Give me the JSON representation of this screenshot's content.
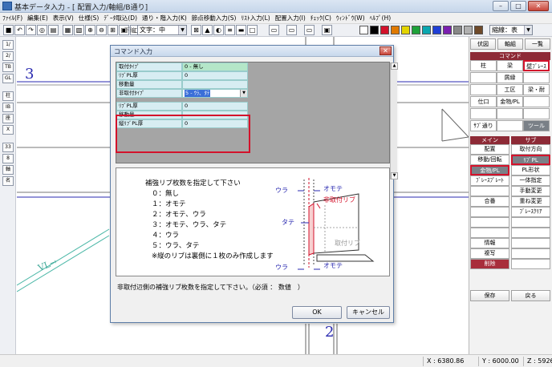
{
  "window": {
    "title": "基本データ入力 - [ 配置入力/軸組/B通り]"
  },
  "menu": [
    "ﾌｧｲﾙ(F)",
    "編集(E)",
    "表示(V)",
    "仕様(S)",
    "ﾃﾞｰﾀ取込(D)",
    "通り・階入力(K)",
    "節点移動入力(S)",
    "ﾘｽﾄ入力(L)",
    "配置入力(I)",
    "ﾁｪｯｸ(C)",
    "ｳｨﾝﾄﾞｳ(W)",
    "ﾍﾙﾌﾟ(H)"
  ],
  "toolbar": {
    "text_combo": "文字：中",
    "text_label": "下線",
    "scale_combo": "縮線：表",
    "color_swatches": [
      "#ffffff",
      "#000000",
      "#d3122b",
      "#e07a00",
      "#e3d400",
      "#1ea23a",
      "#0aa7b0",
      "#1f3fd6",
      "#7a1fb0",
      "#888888",
      "#b0b0b0",
      "#6f4a2a"
    ]
  },
  "lefttb": [
    "1/",
    "2/",
    "TB",
    "GL",
    "柱",
    "IB",
    "座",
    "X",
    "33",
    "8",
    "軸",
    "名"
  ],
  "canvas": {
    "axis_3": "3",
    "axis_2": "2",
    "vl_label": "VL→"
  },
  "rpanel": {
    "top_buttons": [
      "伏図",
      "軸組",
      "一覧"
    ],
    "command_header": "コマンド",
    "command_grid": [
      [
        "柱",
        "梁",
        "壁ﾌﾞﾚｰｽ"
      ],
      [
        "",
        "屑縁",
        ""
      ],
      [
        "",
        "工区",
        "梁・耐"
      ],
      [
        "仕口",
        "金物/PL",
        ""
      ],
      [
        "",
        "",
        ""
      ],
      [
        "ｻﾌﾞ通り",
        "",
        "ツール"
      ]
    ],
    "main_header": "メイン",
    "sub_header": "サブ",
    "main_items": [
      "配置",
      "移動/回転",
      "金物/PL",
      "ﾌﾞﾚｰｽﾌﾟﾚｰﾄ",
      "",
      "合番",
      "",
      "",
      "",
      "情報",
      "複写",
      "削除"
    ],
    "sub_items": [
      "取付方向",
      "ﾘﾌﾞPL",
      "PL形状",
      "一体指定",
      "手動変更",
      "重ね変更",
      "ﾌﾞﾚｰｽｸﾘｱ",
      "",
      "",
      "",
      "",
      ""
    ],
    "save_label": "保存",
    "back_label": "戻る"
  },
  "status": {
    "x": "X : 6380.86",
    "y": "Y : 6000.00",
    "z": "Z : 5926.7"
  },
  "dialog": {
    "title": "コマンド入力",
    "rows": [
      {
        "label": "取付ﾀｲﾌﾟ",
        "value": "0 - 無し"
      },
      {
        "label": "ﾘﾌﾞPL厚",
        "value": "0"
      },
      {
        "label": "移動量",
        "value": ""
      },
      {
        "label": "非取付ﾀｲﾌﾟ",
        "value": "5 - ｳﾗ、ﾀﾃ"
      },
      {
        "label": "ﾘﾌﾞPL厚",
        "value": "0"
      },
      {
        "label": "移動量",
        "value": ""
      },
      {
        "label": "縦ﾘﾌﾞPL厚",
        "value": "0"
      }
    ],
    "instructions": [
      "補強リブ枚数を指定して下さい",
      "０：無し",
      "１：オモテ",
      "２：オモテ、ウラ",
      "３：オモテ、ウラ、タテ",
      "４：ウラ",
      "５：ウラ、タテ",
      "※縦のリブは裏側に１枚のみ作成します"
    ],
    "diagram_labels": {
      "ura_top": "ウラ",
      "omote_top": "オモテ",
      "nontori": "非取付リブ",
      "tate": "タテ",
      "torituke": "取付リブ",
      "ura_bottom": "ウラ",
      "omote_bottom": "オモテ"
    },
    "hint": "非取付辺側の補強リブ枚数を指定して下さい。（必須 ： 数値　）",
    "ok_label": "OK",
    "cancel_label": "キャンセル"
  }
}
